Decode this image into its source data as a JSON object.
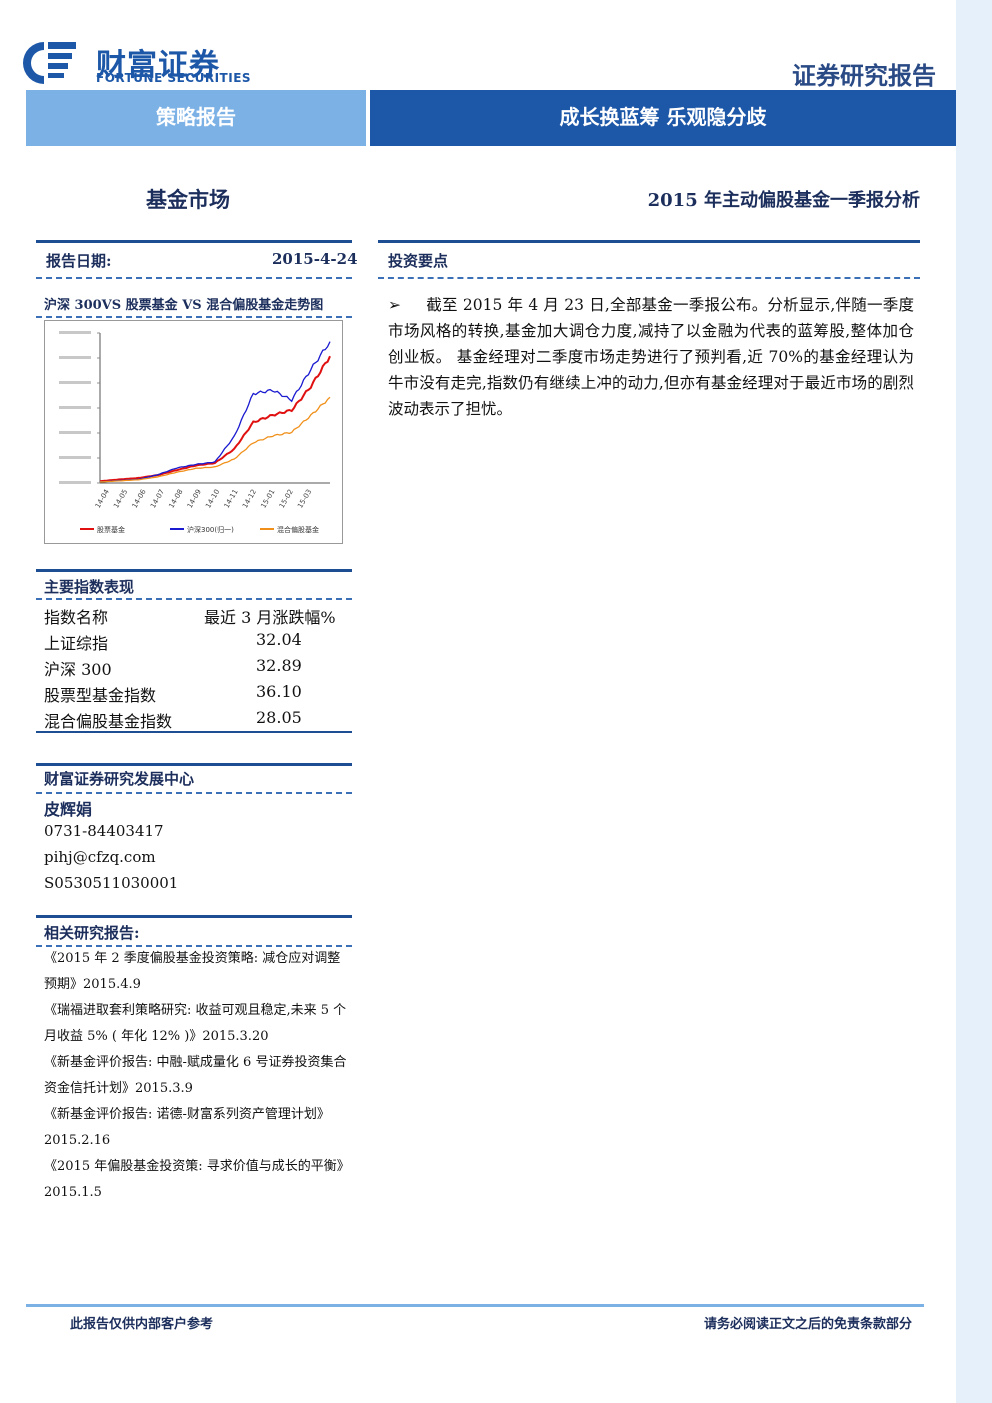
{
  "header": {
    "company_cn": "财富证券",
    "company_en": "FORTUNE SECURITIES",
    "doc_type": "证券研究报告",
    "banner_left": "策略报告",
    "banner_right": "成长换蓝筹  乐观隐分歧"
  },
  "subheader": {
    "sector": "基金市场",
    "title": "2015 年主动偏股基金一季报分析"
  },
  "report_date": {
    "label": "报告日期:",
    "value": "2015-4-24"
  },
  "chart_title": "沪深 300VS 股票基金 VS 混合偏股基金走势图",
  "chart_data": {
    "type": "line",
    "x": [
      "14-04",
      "14-05",
      "14-06",
      "14-07",
      "14-08",
      "14-09",
      "14-10",
      "14-11",
      "14-12",
      "15-01",
      "15-02",
      "15-03"
    ],
    "ylim": [
      4200,
      8400
    ],
    "series": [
      {
        "name": "股票基金",
        "color": "#e01010",
        "values": [
          4250,
          4300,
          4340,
          4420,
          4560,
          4690,
          4760,
          5150,
          5900,
          6100,
          6240,
          6900,
          7750
        ]
      },
      {
        "name": "沪深300(归一)",
        "color": "#1a1ad0",
        "values": [
          4230,
          4270,
          4300,
          4430,
          4620,
          4720,
          4790,
          5500,
          6700,
          6800,
          6520,
          7380,
          8160
        ]
      },
      {
        "name": "混合偏股基金",
        "color": "#f0901a",
        "values": [
          4230,
          4260,
          4290,
          4370,
          4500,
          4610,
          4650,
          4870,
          5330,
          5520,
          5620,
          6090,
          6600
        ]
      }
    ]
  },
  "index_table": {
    "title": "主要指数表现",
    "col1": "指数名称",
    "col2": "最近 3 月涨跌幅%",
    "rows": [
      {
        "name": "上证综指",
        "value": "32.04"
      },
      {
        "name": "沪深 300",
        "value": "32.89"
      },
      {
        "name": "股票型基金指数",
        "value": "36.10"
      },
      {
        "name": "混合偏股基金指数",
        "value": "28.05"
      }
    ]
  },
  "contact": {
    "dept": "财富证券研究发展中心",
    "name": "皮辉娟",
    "phone": "0731-84403417",
    "email": "pihj@cfzq.com",
    "license": "S0530511030001"
  },
  "related": {
    "title": "相关研究报告:",
    "items": [
      "《2015 年 2 季度偏股基金投资策略: 减仓应对调整预期》2015.4.9",
      "《瑞福进取套利策略研究: 收益可观且稳定,未来 5 个月收益 5% ( 年化 12% )》2015.3.20",
      "《新基金评价报告: 中融-赋成量化 6 号证券投资集合资金信托计划》2015.3.9",
      "《新基金评价报告: 诺德-财富系列资产管理计划》2015.2.16",
      "《2015 年偏股基金投资策: 寻求价值与成长的平衡》2015.1.5"
    ]
  },
  "key_points": {
    "title": "投资要点",
    "bullet": "➢",
    "text": "截至 2015 年 4 月 23 日,全部基金一季报公布。分析显示,伴随一季度市场风格的转换,基金加大调仓力度,减持了以金融为代表的蓝筹股,整体加仓创业板。 基金经理对二季度市场走势进行了预判看,近 70%的基金经理认为牛市没有走完,指数仍有继续上冲的动力,但亦有基金经理对于最近市场的剧烈波动表示了担忧。"
  },
  "footer": {
    "left": "此报告仅供内部客户参考",
    "right": "请务必阅读正文之后的免责条款部分"
  }
}
